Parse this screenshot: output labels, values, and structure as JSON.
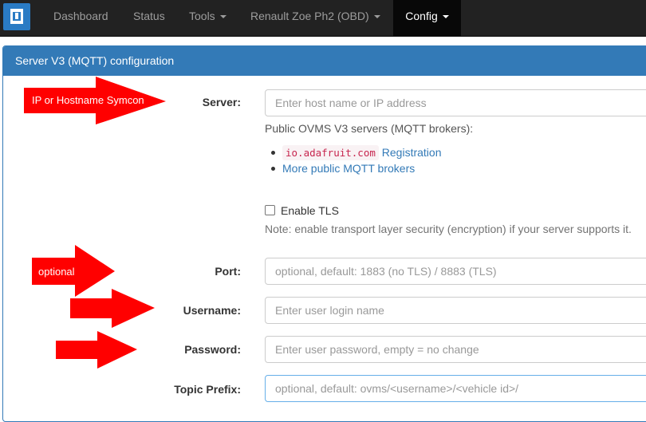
{
  "navbar": {
    "brand_icon": "ovms-logo-icon",
    "items": [
      {
        "label": "Dashboard",
        "dropdown": false
      },
      {
        "label": "Status",
        "dropdown": false
      },
      {
        "label": "Tools",
        "dropdown": true
      },
      {
        "label": "Renault Zoe Ph2 (OBD)",
        "dropdown": true
      },
      {
        "label": "Config",
        "dropdown": true,
        "active": true
      }
    ]
  },
  "panel": {
    "title": "Server V3 (MQTT) configuration"
  },
  "form": {
    "server": {
      "label": "Server:",
      "placeholder": "Enter host name or IP address",
      "value": ""
    },
    "server_help": "Public OVMS V3 servers (MQTT brokers):",
    "brokers": [
      {
        "code": "io.adafruit.com",
        "link": "Registration"
      },
      {
        "link": "More public MQTT brokers"
      }
    ],
    "tls": {
      "label": "Enable TLS",
      "checked": false,
      "note": "Note: enable transport layer security (encryption) if your server supports it."
    },
    "port": {
      "label": "Port:",
      "placeholder": "optional, default: 1883 (no TLS) / 8883 (TLS)",
      "value": ""
    },
    "username": {
      "label": "Username:",
      "placeholder": "Enter user login name",
      "value": ""
    },
    "password": {
      "label": "Password:",
      "placeholder": "Enter user password, empty = no change",
      "value": ""
    },
    "topic_prefix": {
      "label": "Topic Prefix:",
      "placeholder": "optional, default: ovms/<username>/<vehicle id>/",
      "value": ""
    }
  },
  "annotations": {
    "server_arrow_text": "IP or Hostname Symcon",
    "port_arrow_text": "optional",
    "arrow_color": "#ff0000"
  },
  "colors": {
    "navbar_bg": "#222222",
    "panel_primary": "#337ab7",
    "code_text": "#c7254e"
  }
}
